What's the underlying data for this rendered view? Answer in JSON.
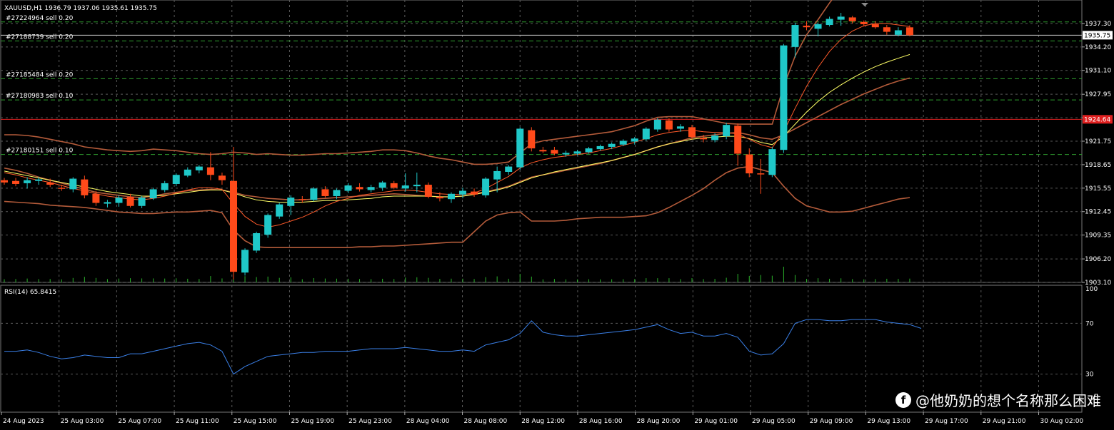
{
  "header": {
    "symbol_line": "XAUUSD,H1  1936.79 1937.06 1935.61 1935.75",
    "rsi_label": "RSI(14) 65.8415"
  },
  "watermark": {
    "text": "@他奶奶的想个名称那么困难",
    "icon": "facebook-icon"
  },
  "colors": {
    "background": "#000000",
    "grid": "#5a5a5a",
    "bull": "#1fc8c8",
    "bear": "#ff4a1a",
    "bands": "#b45b3a",
    "ma_fast": "#ff5a2a",
    "ma_slow": "#ffff66",
    "rsi": "#3a7fe6",
    "order_line": "#2e9e2e",
    "price_line": "#c8c8c8",
    "alert_line": "#e02020"
  },
  "chart_data": [
    {
      "type": "candlestick",
      "symbol": "XAUUSD",
      "timeframe": "H1",
      "ylim": [
        1903.1,
        1940.4
      ],
      "y_ticks": [
        "1937.30",
        "1934.20",
        "1931.10",
        "1927.95",
        "1924.85",
        "1921.75",
        "1918.65",
        "1915.55",
        "1912.45",
        "1909.35",
        "1906.20",
        "1903.10"
      ],
      "x_ticks": [
        "24 Aug 2023",
        "25 Aug 03:00",
        "25 Aug 07:00",
        "25 Aug 11:00",
        "25 Aug 15:00",
        "25 Aug 19:00",
        "25 Aug 23:00",
        "28 Aug 04:00",
        "28 Aug 08:00",
        "28 Aug 12:00",
        "28 Aug 16:00",
        "28 Aug 20:00",
        "29 Aug 01:00",
        "29 Aug 05:00",
        "29 Aug 09:00",
        "29 Aug 13:00",
        "29 Aug 17:00",
        "29 Aug 21:00",
        "30 Aug 02:00"
      ],
      "current_price": "1935.75",
      "alert_price": "1924.64",
      "orders": [
        {
          "label": "#27224964 sell 0.20",
          "price": 1937.5
        },
        {
          "label": "#27188739 sell 0.20",
          "price": 1935.0
        },
        {
          "label": "#27185484 sell 0.20",
          "price": 1930.0
        },
        {
          "label": "#27180983 sell 0.10",
          "price": 1927.2
        },
        {
          "label": "#27180151 sell 0.10",
          "price": 1920.0
        }
      ],
      "candles": [
        [
          1916.6,
          1916.9,
          1916.0,
          1916.3
        ],
        [
          1916.5,
          1916.9,
          1915.8,
          1916.1
        ],
        [
          1916.2,
          1917.0,
          1915.5,
          1916.6
        ],
        [
          1916.5,
          1917.0,
          1916.0,
          1916.7
        ],
        [
          1916.3,
          1916.8,
          1915.7,
          1916.0
        ],
        [
          1915.6,
          1916.0,
          1915.2,
          1915.5
        ],
        [
          1915.4,
          1917.0,
          1915.0,
          1916.8
        ],
        [
          1916.7,
          1917.2,
          1914.2,
          1914.6
        ],
        [
          1914.8,
          1915.2,
          1913.2,
          1913.6
        ],
        [
          1913.5,
          1914.0,
          1913.0,
          1913.7
        ],
        [
          1913.6,
          1914.6,
          1913.1,
          1914.3
        ],
        [
          1914.4,
          1914.8,
          1913.0,
          1913.2
        ],
        [
          1913.2,
          1914.5,
          1912.9,
          1914.3
        ],
        [
          1914.2,
          1915.6,
          1914.0,
          1915.4
        ],
        [
          1915.3,
          1916.5,
          1915.0,
          1916.2
        ],
        [
          1916.1,
          1917.5,
          1915.8,
          1917.3
        ],
        [
          1917.2,
          1918.3,
          1917.0,
          1918.0
        ],
        [
          1917.9,
          1918.6,
          1917.5,
          1918.4
        ],
        [
          1918.3,
          1920.3,
          1916.6,
          1917.3
        ],
        [
          1917.2,
          1917.6,
          1916.0,
          1916.6
        ],
        [
          1916.5,
          1921.0,
          1903.5,
          1904.5
        ],
        [
          1904.4,
          1907.6,
          1904.0,
          1907.4
        ],
        [
          1907.3,
          1909.8,
          1907.0,
          1909.6
        ],
        [
          1909.4,
          1912.2,
          1909.0,
          1912.0
        ],
        [
          1911.8,
          1913.6,
          1911.5,
          1913.4
        ],
        [
          1913.2,
          1914.6,
          1912.0,
          1914.3
        ],
        [
          1914.1,
          1914.5,
          1913.6,
          1914.0
        ],
        [
          1914.0,
          1915.7,
          1913.8,
          1915.5
        ],
        [
          1915.4,
          1915.8,
          1914.3,
          1914.5
        ],
        [
          1914.5,
          1915.5,
          1914.1,
          1915.3
        ],
        [
          1915.2,
          1916.2,
          1914.9,
          1915.9
        ],
        [
          1915.7,
          1916.2,
          1915.1,
          1915.4
        ],
        [
          1915.3,
          1916.0,
          1915.0,
          1915.7
        ],
        [
          1915.6,
          1916.5,
          1915.2,
          1916.3
        ],
        [
          1916.2,
          1916.5,
          1915.4,
          1915.6
        ],
        [
          1915.5,
          1917.5,
          1915.1,
          1915.9
        ],
        [
          1915.8,
          1917.6,
          1915.0,
          1916.0
        ],
        [
          1916.0,
          1916.3,
          1914.2,
          1914.4
        ],
        [
          1914.4,
          1915.0,
          1913.8,
          1914.2
        ],
        [
          1914.1,
          1915.0,
          1913.6,
          1914.8
        ],
        [
          1914.7,
          1915.6,
          1914.2,
          1915.2
        ],
        [
          1915.1,
          1915.5,
          1914.4,
          1914.7
        ],
        [
          1914.6,
          1917.0,
          1914.3,
          1916.8
        ],
        [
          1916.7,
          1918.4,
          1915.0,
          1917.8
        ],
        [
          1917.7,
          1918.6,
          1917.3,
          1918.4
        ],
        [
          1918.3,
          1923.6,
          1918.0,
          1923.4
        ],
        [
          1923.2,
          1923.6,
          1920.4,
          1920.8
        ],
        [
          1920.6,
          1921.0,
          1920.2,
          1920.4
        ],
        [
          1920.6,
          1921.0,
          1919.9,
          1920.1
        ],
        [
          1920.0,
          1920.5,
          1919.7,
          1920.2
        ],
        [
          1920.1,
          1920.6,
          1919.9,
          1920.4
        ],
        [
          1920.3,
          1921.0,
          1920.1,
          1920.8
        ],
        [
          1920.7,
          1921.3,
          1920.5,
          1921.1
        ],
        [
          1921.0,
          1921.6,
          1920.7,
          1921.4
        ],
        [
          1921.3,
          1922.0,
          1921.1,
          1921.8
        ],
        [
          1921.7,
          1922.3,
          1921.3,
          1922.1
        ],
        [
          1922.0,
          1923.6,
          1921.8,
          1923.4
        ],
        [
          1923.3,
          1924.8,
          1923.0,
          1924.6
        ],
        [
          1924.5,
          1924.8,
          1923.0,
          1923.3
        ],
        [
          1923.4,
          1924.0,
          1923.0,
          1923.7
        ],
        [
          1923.6,
          1923.9,
          1922.0,
          1922.3
        ],
        [
          1922.2,
          1922.6,
          1921.6,
          1922.0
        ],
        [
          1921.9,
          1922.8,
          1921.6,
          1922.5
        ],
        [
          1922.4,
          1924.2,
          1922.0,
          1923.9
        ],
        [
          1923.8,
          1924.1,
          1918.5,
          1920.1
        ],
        [
          1920.0,
          1920.8,
          1917.0,
          1917.5
        ],
        [
          1917.5,
          1919.4,
          1914.8,
          1917.4
        ],
        [
          1917.3,
          1921.0,
          1917.0,
          1920.7
        ],
        [
          1920.6,
          1934.6,
          1920.2,
          1934.4
        ],
        [
          1934.2,
          1937.4,
          1932.8,
          1937.1
        ],
        [
          1937.0,
          1937.6,
          1936.4,
          1936.8
        ],
        [
          1936.6,
          1937.4,
          1935.6,
          1937.2
        ],
        [
          1937.1,
          1938.2,
          1936.9,
          1937.9
        ],
        [
          1937.8,
          1938.7,
          1937.0,
          1938.2
        ],
        [
          1938.1,
          1938.3,
          1937.3,
          1937.6
        ],
        [
          1937.5,
          1937.7,
          1936.9,
          1937.2
        ],
        [
          1937.2,
          1937.6,
          1936.6,
          1936.8
        ],
        [
          1936.8,
          1937.1,
          1935.8,
          1936.2
        ],
        [
          1935.8,
          1936.8,
          1935.6,
          1936.4
        ],
        [
          1936.79,
          1937.06,
          1935.61,
          1935.75
        ]
      ],
      "bb_upper": [
        1922.6,
        1922.6,
        1922.5,
        1922.3,
        1922.0,
        1921.7,
        1921.4,
        1921.0,
        1920.8,
        1920.6,
        1920.5,
        1920.4,
        1920.5,
        1920.7,
        1920.6,
        1920.5,
        1920.3,
        1920.1,
        1920.0,
        1920.1,
        1920.3,
        1920.2,
        1920.0,
        1920.1,
        1920.0,
        1919.9,
        1919.9,
        1920.0,
        1920.1,
        1920.1,
        1920.2,
        1920.3,
        1920.4,
        1920.6,
        1920.6,
        1920.5,
        1920.2,
        1919.8,
        1919.5,
        1919.3,
        1919.0,
        1918.7,
        1918.7,
        1918.8,
        1919.0,
        1920.2,
        1921.4,
        1921.8,
        1922.0,
        1922.2,
        1922.4,
        1922.6,
        1922.8,
        1923.0,
        1923.4,
        1923.8,
        1924.4,
        1924.9,
        1925.0,
        1925.0,
        1925.0,
        1924.7,
        1924.4,
        1924.1,
        1924.0,
        1924.0,
        1924.0,
        1924.0,
        1929.0,
        1933.0,
        1935.8,
        1937.8,
        1940.0,
        1942.0,
        1943.0,
        1943.5,
        1943.7,
        1943.8,
        1943.8,
        1943.8
      ],
      "bb_middle": [
        1918.2,
        1917.9,
        1917.5,
        1917.0,
        1916.6,
        1916.2,
        1915.8,
        1915.4,
        1915.0,
        1914.8,
        1914.6,
        1914.4,
        1914.3,
        1914.5,
        1914.8,
        1915.0,
        1915.2,
        1915.3,
        1915.4,
        1915.3,
        1915.0,
        1914.6,
        1914.4,
        1914.2,
        1914.1,
        1914.0,
        1914.0,
        1914.1,
        1914.2,
        1914.3,
        1914.4,
        1914.5,
        1914.6,
        1914.7,
        1914.8,
        1914.7,
        1914.6,
        1914.5,
        1914.4,
        1914.4,
        1914.5,
        1914.8,
        1915.1,
        1915.4,
        1915.8,
        1916.4,
        1917.0,
        1917.3,
        1917.6,
        1917.9,
        1918.2,
        1918.5,
        1918.8,
        1919.2,
        1919.6,
        1920.0,
        1920.5,
        1921.0,
        1921.4,
        1921.8,
        1922.2,
        1922.4,
        1922.6,
        1922.8,
        1922.9,
        1922.6,
        1922.2,
        1922.0,
        1922.6,
        1923.4,
        1924.2,
        1925.0,
        1925.8,
        1926.6,
        1927.3,
        1928.0,
        1928.6,
        1929.2,
        1929.7,
        1930.1
      ],
      "bb_lower": [
        1913.8,
        1913.7,
        1913.6,
        1913.5,
        1913.3,
        1913.2,
        1913.1,
        1913.0,
        1912.8,
        1912.6,
        1912.4,
        1912.3,
        1912.2,
        1912.2,
        1912.3,
        1912.4,
        1912.4,
        1912.5,
        1912.6,
        1912.3,
        1910.0,
        1908.6,
        1907.8,
        1907.7,
        1907.7,
        1907.7,
        1907.7,
        1907.7,
        1907.7,
        1907.7,
        1907.7,
        1907.8,
        1907.8,
        1907.9,
        1907.9,
        1908.0,
        1908.1,
        1908.2,
        1908.3,
        1908.4,
        1908.4,
        1909.8,
        1911.2,
        1912.0,
        1912.3,
        1912.4,
        1911.2,
        1911.2,
        1911.2,
        1911.3,
        1911.5,
        1911.6,
        1911.7,
        1911.7,
        1911.7,
        1911.8,
        1911.9,
        1912.3,
        1913.0,
        1913.8,
        1914.6,
        1915.5,
        1916.6,
        1917.6,
        1918.2,
        1918.4,
        1918.0,
        1917.6,
        1915.8,
        1914.2,
        1913.2,
        1912.8,
        1912.4,
        1912.4,
        1912.5,
        1912.9,
        1913.3,
        1913.7,
        1914.1,
        1914.3
      ],
      "ma_fast": [
        1917.6,
        1917.3,
        1916.9,
        1916.6,
        1916.3,
        1915.9,
        1915.5,
        1915.2,
        1914.8,
        1914.5,
        1914.3,
        1914.1,
        1914.0,
        1914.2,
        1914.5,
        1914.9,
        1915.3,
        1915.6,
        1915.6,
        1915.4,
        1913.5,
        1911.8,
        1910.8,
        1910.4,
        1910.7,
        1911.2,
        1911.7,
        1912.4,
        1913.2,
        1913.8,
        1914.2,
        1914.6,
        1914.8,
        1915.0,
        1915.2,
        1915.3,
        1915.2,
        1915.0,
        1914.8,
        1914.7,
        1914.7,
        1914.9,
        1915.5,
        1916.3,
        1917.1,
        1918.2,
        1918.9,
        1919.3,
        1919.6,
        1919.8,
        1920.0,
        1920.2,
        1920.5,
        1920.8,
        1921.2,
        1921.6,
        1922.1,
        1922.6,
        1922.9,
        1923.1,
        1923.2,
        1923.0,
        1922.9,
        1922.9,
        1922.7,
        1922.0,
        1921.3,
        1920.9,
        1923.0,
        1926.1,
        1929.0,
        1931.5,
        1933.6,
        1935.2,
        1936.3,
        1937.0,
        1937.3,
        1937.3,
        1937.1,
        1936.9
      ],
      "ma_slow": [
        1917.8,
        1917.5,
        1917.2,
        1916.9,
        1916.6,
        1916.3,
        1916.0,
        1915.7,
        1915.4,
        1915.1,
        1914.9,
        1914.7,
        1914.5,
        1914.5,
        1914.6,
        1914.8,
        1915.0,
        1915.2,
        1915.3,
        1915.3,
        1914.9,
        1914.4,
        1914.0,
        1913.8,
        1913.7,
        1913.7,
        1913.7,
        1913.8,
        1913.9,
        1913.9,
        1914.0,
        1914.1,
        1914.2,
        1914.4,
        1914.5,
        1914.5,
        1914.5,
        1914.5,
        1914.4,
        1914.4,
        1914.5,
        1914.7,
        1915.0,
        1915.3,
        1915.7,
        1916.3,
        1916.9,
        1917.3,
        1917.7,
        1918.0,
        1918.3,
        1918.6,
        1918.9,
        1919.2,
        1919.6,
        1920.0,
        1920.5,
        1921.0,
        1921.4,
        1921.7,
        1922.0,
        1922.2,
        1922.3,
        1922.4,
        1922.4,
        1922.1,
        1921.6,
        1921.3,
        1922.4,
        1924.0,
        1925.6,
        1927.0,
        1928.2,
        1929.2,
        1930.1,
        1930.9,
        1931.6,
        1932.2,
        1932.7,
        1933.2
      ]
    },
    {
      "type": "line",
      "name": "RSI(14)",
      "ylim": [
        0,
        100
      ],
      "y_ticks": [
        "100",
        "70",
        "30"
      ],
      "levels": [
        70,
        30
      ],
      "values": [
        48,
        48,
        49,
        47,
        44,
        42,
        43,
        45,
        44,
        43,
        43,
        46,
        46,
        48,
        50,
        52,
        54,
        55,
        53,
        48,
        30,
        36,
        40,
        44,
        45,
        46,
        47,
        47,
        48,
        48,
        48,
        49,
        50,
        50,
        50,
        51,
        50,
        49,
        48,
        48,
        49,
        48,
        53,
        55,
        57,
        62,
        72,
        63,
        61,
        60,
        60,
        61,
        62,
        63,
        64,
        65,
        67,
        69,
        65,
        62,
        63,
        60,
        60,
        62,
        59,
        48,
        45,
        46,
        54,
        70,
        73,
        73,
        72,
        72,
        73,
        73,
        73,
        71,
        70,
        69,
        66
      ]
    }
  ]
}
